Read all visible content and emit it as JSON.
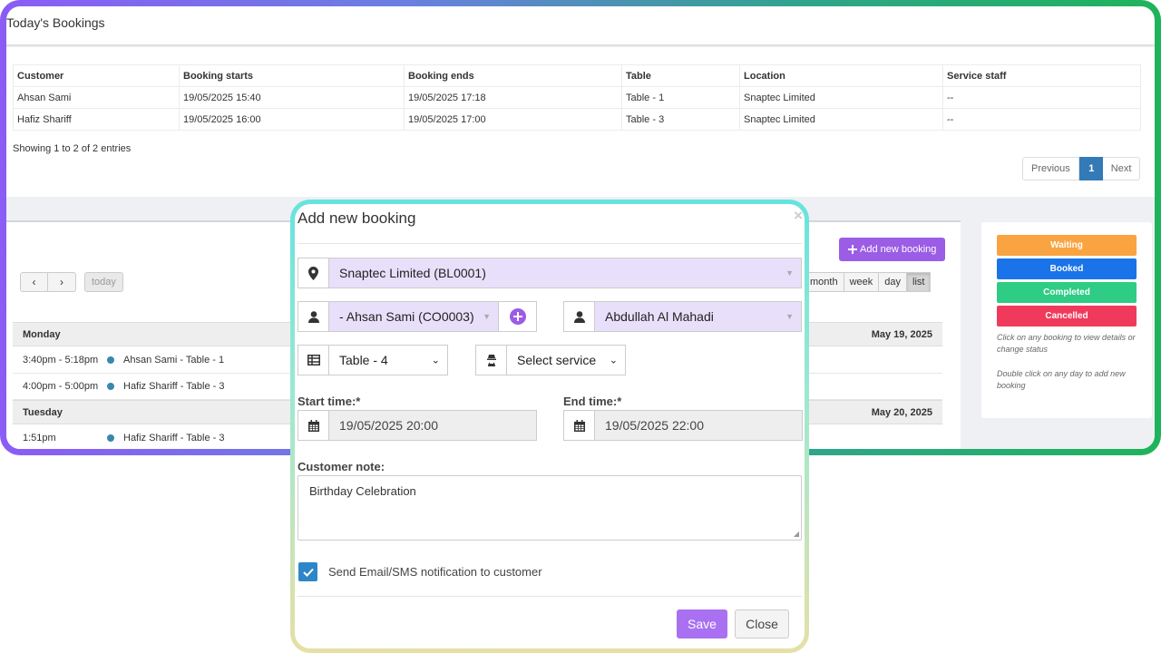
{
  "bookings": {
    "title": "Today's Bookings",
    "columns": [
      "Customer",
      "Booking starts",
      "Booking ends",
      "Table",
      "Location",
      "Service staff"
    ],
    "rows": [
      [
        "Ahsan Sami",
        "19/05/2025 15:40",
        "19/05/2025 17:18",
        "Table - 1",
        "Snaptec Limited",
        "--"
      ],
      [
        "Hafiz Shariff",
        "19/05/2025 16:00",
        "19/05/2025 17:00",
        "Table - 3",
        "Snaptec Limited",
        "--"
      ]
    ],
    "showing": "Showing 1 to 2 of 2 entries",
    "pager": {
      "previous": "Previous",
      "current": "1",
      "next": "Next"
    }
  },
  "calendar": {
    "prev_glyph": "‹",
    "next_glyph": "›",
    "today": "today",
    "add_booking": "Add new booking",
    "views": [
      "month",
      "week",
      "day",
      "list"
    ],
    "active_view": "list",
    "days": [
      {
        "name": "Monday",
        "date": "May 19, 2025",
        "events": [
          {
            "time": "3:40pm - 5:18pm",
            "title": "Ahsan Sami - Table - 1"
          },
          {
            "time": "4:00pm - 5:00pm",
            "title": "Hafiz Shariff - Table - 3"
          }
        ]
      },
      {
        "name": "Tuesday",
        "date": "May 20, 2025",
        "events": [
          {
            "time": "1:51pm",
            "title": "Hafiz Shariff - Table - 3"
          }
        ]
      }
    ]
  },
  "legend": {
    "statuses": [
      {
        "label": "Waiting",
        "color": "#f9a441"
      },
      {
        "label": "Booked",
        "color": "#1a73e8"
      },
      {
        "label": "Completed",
        "color": "#2ecc84"
      },
      {
        "label": "Cancelled",
        "color": "#f03a5c"
      }
    ],
    "note1": "Click on any booking to view details or change status",
    "note2": "Double click on any day to add new booking"
  },
  "modal": {
    "title": "Add new booking",
    "close_glyph": "×",
    "location": "Snaptec Limited (BL0001)",
    "customer": "- Ahsan Sami (CO0003)",
    "staff": "Abdullah Al Mahadi",
    "table": "Table - 4",
    "service": "Select service",
    "start_label": "Start time:*",
    "start_value": "19/05/2025 20:00",
    "end_label": "End time:*",
    "end_value": "19/05/2025 22:00",
    "note_label": "Customer note:",
    "note_value": "Birthday Celebration",
    "notify_label": "Send Email/SMS notification to customer",
    "save": "Save",
    "close": "Close"
  },
  "colors": {
    "accent": "#9b5de5",
    "pager_active": "#337ab7",
    "select_bg": "#e8e0fa"
  }
}
